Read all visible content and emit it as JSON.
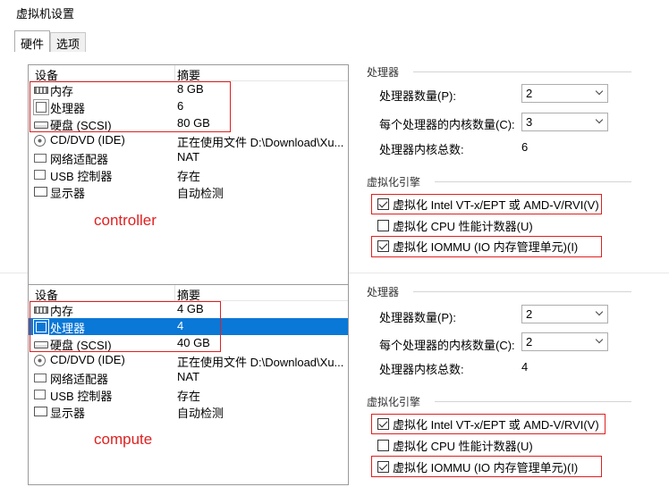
{
  "window": {
    "title": "虚拟机设置"
  },
  "tabs": [
    {
      "label": "硬件",
      "active": true
    },
    {
      "label": "选项",
      "active": false
    }
  ],
  "list_headers": {
    "device": "设备",
    "summary": "摘要"
  },
  "panels": [
    {
      "name": "controller",
      "annotation": "controller",
      "devices": [
        {
          "icon": "memory-icon",
          "name": "内存",
          "summary": "8 GB",
          "selected": false
        },
        {
          "icon": "processor-icon",
          "name": "处理器",
          "summary": "6",
          "selected": false
        },
        {
          "icon": "hard-disk-icon",
          "name": "硬盘 (SCSI)",
          "summary": "80 GB",
          "selected": false
        },
        {
          "icon": "cd-dvd-icon",
          "name": "CD/DVD (IDE)",
          "summary": "正在使用文件 D:\\Download\\Xu...",
          "selected": false
        },
        {
          "icon": "network-adapter-icon",
          "name": "网络适配器",
          "summary": "NAT",
          "selected": false
        },
        {
          "icon": "usb-controller-icon",
          "name": "USB 控制器",
          "summary": "存在",
          "selected": false
        },
        {
          "icon": "display-icon",
          "name": "显示器",
          "summary": "自动检测",
          "selected": false
        }
      ],
      "processors": {
        "group_title": "处理器",
        "count_label": "处理器数量(P):",
        "count_value": "2",
        "cores_label": "每个处理器的内核数量(C):",
        "cores_value": "3",
        "total_label": "处理器内核总数:",
        "total_value": "6"
      },
      "virtualization": {
        "group_title": "虚拟化引擎",
        "options": [
          {
            "label": "虚拟化 Intel VT-x/EPT 或 AMD-V/RVI(V)",
            "checked": true
          },
          {
            "label": "虚拟化 CPU 性能计数器(U)",
            "checked": false
          },
          {
            "label": "虚拟化 IOMMU (IO 内存管理单元)(I)",
            "checked": true
          }
        ]
      }
    },
    {
      "name": "compute",
      "annotation": "compute",
      "devices": [
        {
          "icon": "memory-icon",
          "name": "内存",
          "summary": "4 GB",
          "selected": false
        },
        {
          "icon": "processor-icon",
          "name": "处理器",
          "summary": "4",
          "selected": true
        },
        {
          "icon": "hard-disk-icon",
          "name": "硬盘 (SCSI)",
          "summary": "40 GB",
          "selected": false
        },
        {
          "icon": "cd-dvd-icon",
          "name": "CD/DVD (IDE)",
          "summary": "正在使用文件 D:\\Download\\Xu...",
          "selected": false
        },
        {
          "icon": "network-adapter-icon",
          "name": "网络适配器",
          "summary": "NAT",
          "selected": false
        },
        {
          "icon": "usb-controller-icon",
          "name": "USB 控制器",
          "summary": "存在",
          "selected": false
        },
        {
          "icon": "display-icon",
          "name": "显示器",
          "summary": "自动检测",
          "selected": false
        }
      ],
      "processors": {
        "group_title": "处理器",
        "count_label": "处理器数量(P):",
        "count_value": "2",
        "cores_label": "每个处理器的内核数量(C):",
        "cores_value": "2",
        "total_label": "处理器内核总数:",
        "total_value": "4"
      },
      "virtualization": {
        "group_title": "虚拟化引擎",
        "options": [
          {
            "label": "虚拟化 Intel VT-x/EPT 或 AMD-V/RVI(V)",
            "checked": true
          },
          {
            "label": "虚拟化 CPU 性能计数器(U)",
            "checked": false
          },
          {
            "label": "虚拟化 IOMMU (IO 内存管理单元)(I)",
            "checked": true
          }
        ]
      }
    }
  ],
  "colors": {
    "annotation_red": "#e02020",
    "selection_blue": "#0a78d7"
  }
}
